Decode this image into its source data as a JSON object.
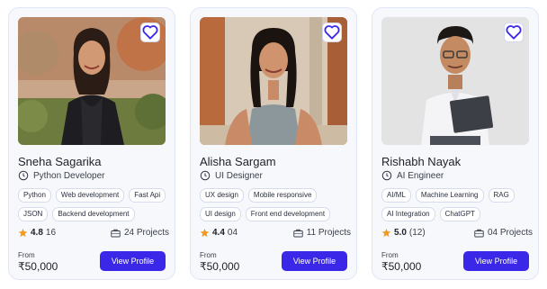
{
  "colors": {
    "accent": "#3b27e8",
    "star": "#f29a1f",
    "card_bg": "#f6f8fc"
  },
  "cards": [
    {
      "name": "Sneha Sagarika",
      "role": "Python Developer",
      "tags": [
        "Python",
        "Web development",
        "Fast Api",
        "JSON",
        "Backend development"
      ],
      "rating": "4.8",
      "reviews": "16",
      "projects": "24 Projects",
      "from_label": "From",
      "price": "₹50,000",
      "button": "View Profile"
    },
    {
      "name": "Alisha Sargam",
      "role": "UI Designer",
      "tags": [
        "UX design",
        "Mobile responsive",
        "UI design",
        "Front end development"
      ],
      "rating": "4.4",
      "reviews": "04",
      "projects": "11 Projects",
      "from_label": "From",
      "price": "₹50,000",
      "button": "View Profile"
    },
    {
      "name": "Rishabh Nayak",
      "role": "AI Engineer",
      "tags": [
        "AI/ML",
        "Machine Learning",
        "RAG",
        "AI Integration",
        "ChatGPT"
      ],
      "rating": "5.0",
      "reviews": "(12)",
      "projects": "04 Projects",
      "from_label": "From",
      "price": "₹50,000",
      "button": "View Profile"
    }
  ]
}
